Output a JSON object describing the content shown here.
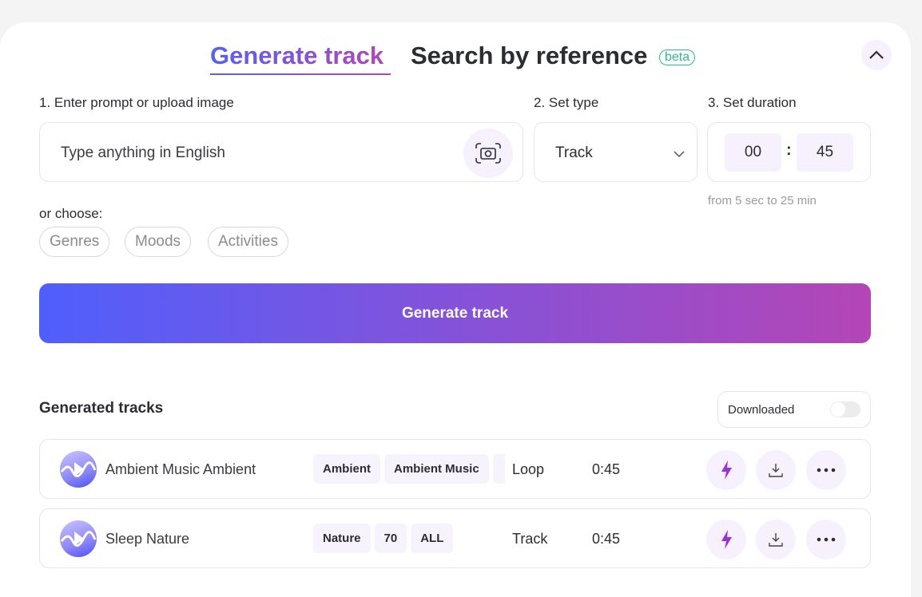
{
  "tabs": {
    "generate": "Generate track",
    "search": "Search by reference",
    "beta": "beta"
  },
  "step1": {
    "label": "1. Enter prompt or upload image",
    "placeholder": "Type anything in English"
  },
  "step2": {
    "label": "2. Set type",
    "value": "Track"
  },
  "step3": {
    "label": "3. Set duration",
    "minutes": "00",
    "separator": ":",
    "seconds": "45",
    "hint": "from 5 sec to 25 min"
  },
  "choose": {
    "label": "or choose:",
    "chips": [
      "Genres",
      "Moods",
      "Activities"
    ]
  },
  "generate_button": "Generate track",
  "generated": {
    "title": "Generated tracks",
    "toggle_label": "Downloaded",
    "toggle_on": false
  },
  "tracks": [
    {
      "name": "Ambient Music Ambient",
      "tags": [
        "Ambient",
        "Ambient Music",
        ""
      ],
      "type": "Loop",
      "duration": "0:45"
    },
    {
      "name": "Sleep Nature",
      "tags": [
        "Nature",
        "70",
        "ALL"
      ],
      "type": "Track",
      "duration": "0:45"
    }
  ],
  "colors": {
    "accent_start": "#4f5ffc",
    "accent_end": "#b446b6",
    "beta": "#2fb98c",
    "bolt": "#9b2fe0"
  }
}
